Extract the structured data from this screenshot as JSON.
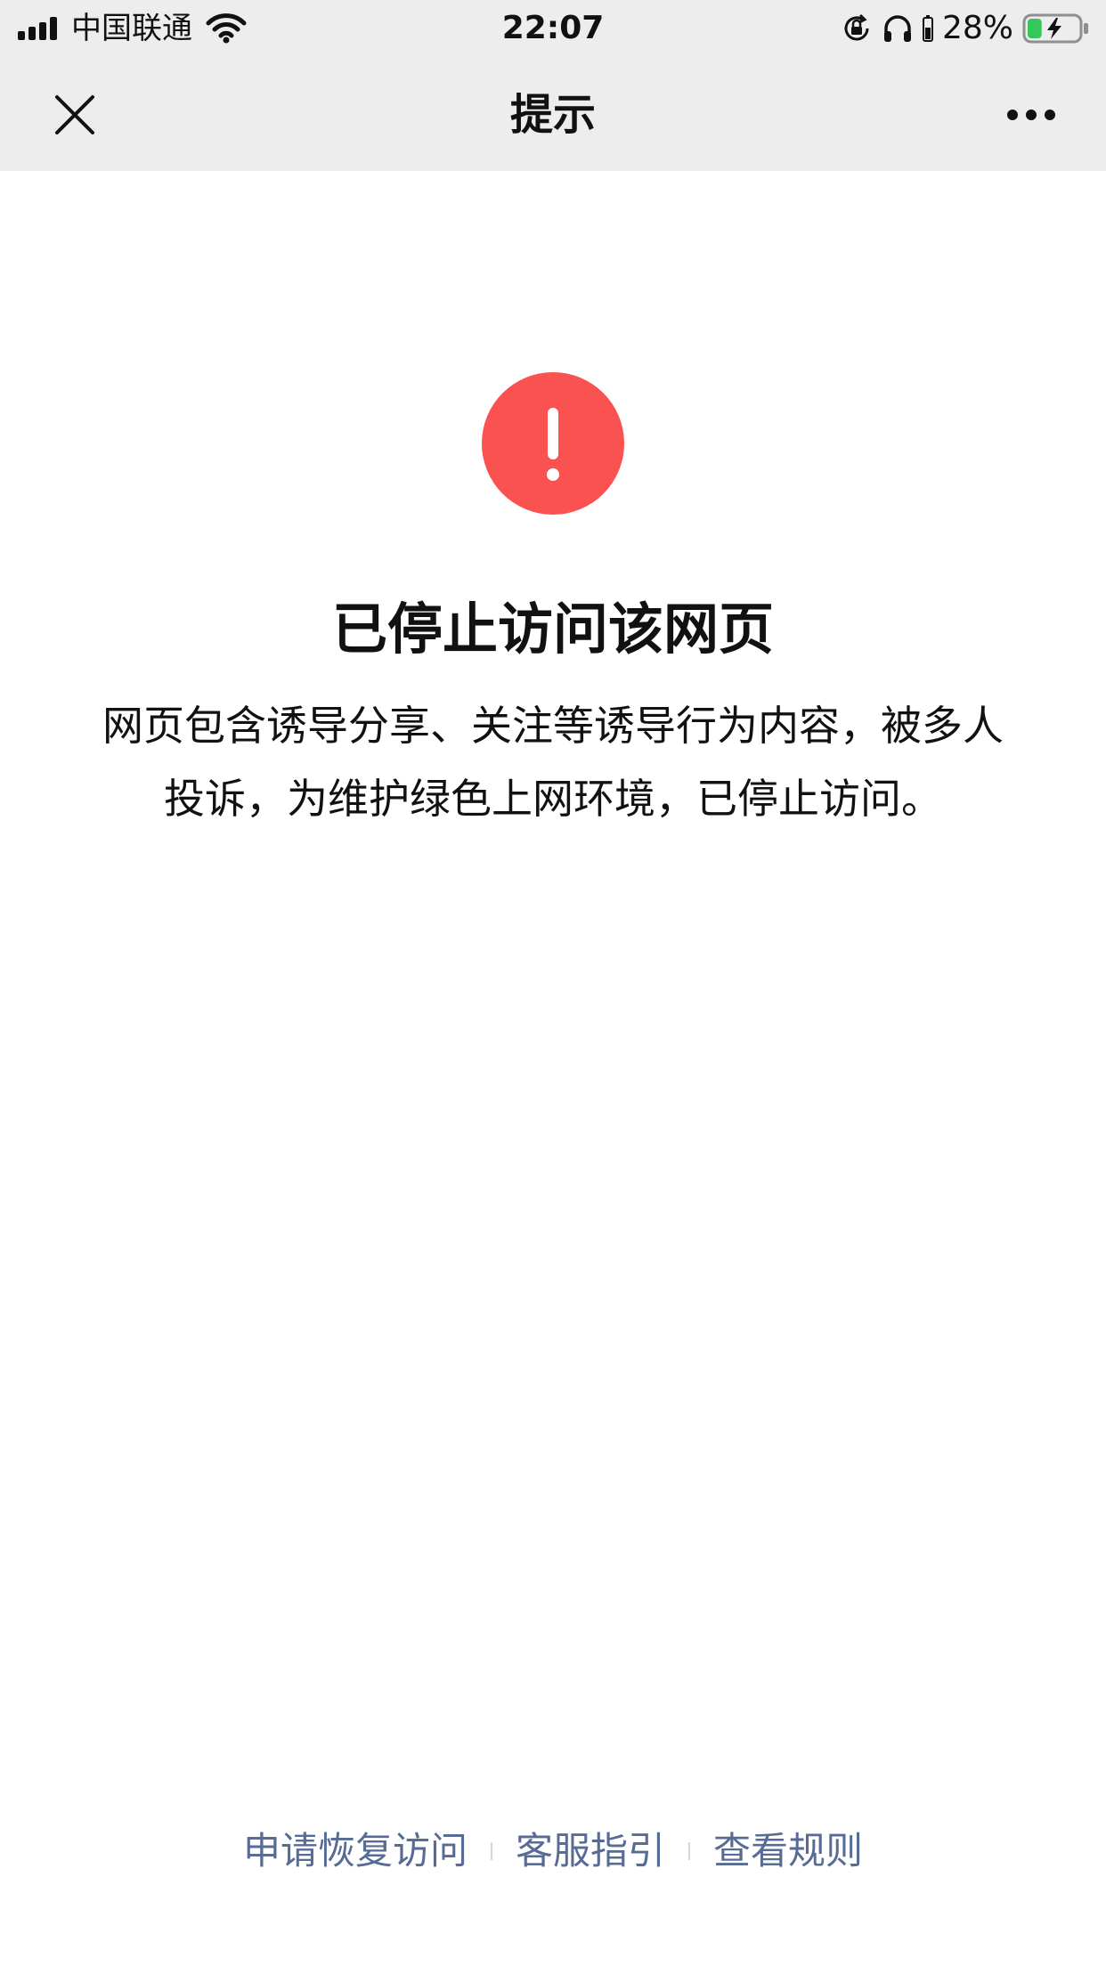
{
  "status_bar": {
    "carrier": "中国联通",
    "time": "22:07",
    "battery_percent": "28%",
    "battery_fraction": 0.28,
    "battery_color": "#34c759",
    "icons": [
      "signal-icon",
      "wifi-icon",
      "rotation-lock-icon",
      "headphones-icon",
      "battery-icon"
    ]
  },
  "nav": {
    "title": "提示",
    "left_icon": "close-icon",
    "right_icon": "more-icon"
  },
  "content": {
    "icon": "warning-icon",
    "icon_color": "#fa5151",
    "title": "已停止访问该网页",
    "message": "网页包含诱导分享、关注等诱导行为内容，被多人投诉，为维护绿色上网环境，已停止访问。"
  },
  "footer": {
    "link_color": "#576b95",
    "links": [
      {
        "label": "申请恢复访问"
      },
      {
        "label": "客服指引"
      },
      {
        "label": "查看规则"
      }
    ]
  }
}
